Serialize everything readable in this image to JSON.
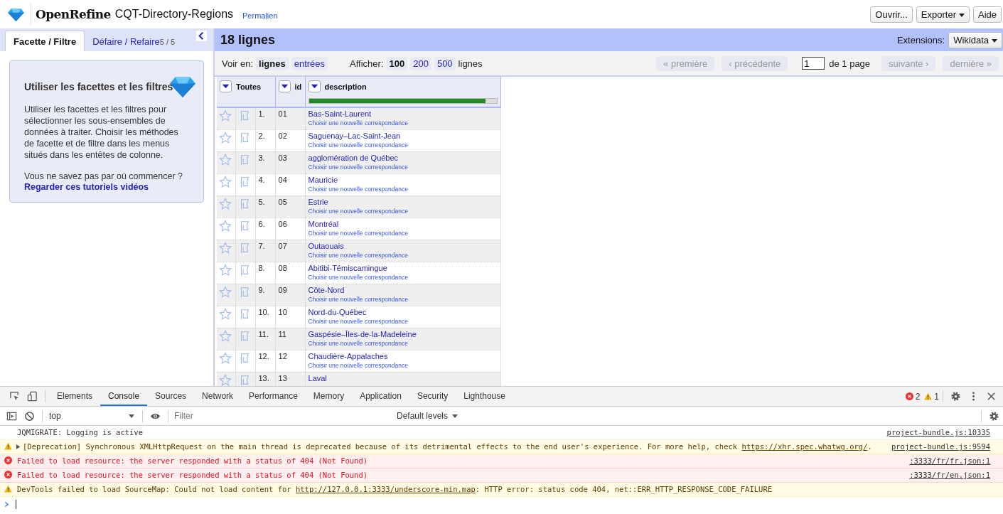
{
  "header": {
    "brand": "OpenRefine",
    "project": "CQT-Directory-Regions",
    "permalink": "Permalien",
    "buttons": [
      {
        "label": "Ouvrir...",
        "dropdown": false
      },
      {
        "label": "Exporter",
        "dropdown": true
      },
      {
        "label": "Aide",
        "dropdown": false
      }
    ]
  },
  "left_panel": {
    "tabs": [
      {
        "label": "Facette / Filtre",
        "selected": true
      },
      {
        "label": "Défaire / Refaire",
        "count": "5 / 5",
        "selected": false
      }
    ],
    "help": {
      "title": "Utiliser les facettes et les filtres",
      "body": "Utiliser les facettes et les filtres pour sélectionner les sous-ensembles de données à traiter. Choisir les méthodes de facette et de filtre dans les menus situés dans les entêtes de colonne.",
      "question": "Vous ne savez pas par où commencer ?",
      "link": "Regarder ces tutoriels vidéos"
    }
  },
  "summary": {
    "title": "18 lignes",
    "extensions_label": "Extensions:",
    "extensions_button": "Wikidata"
  },
  "toolbar": {
    "view_label": "Voir en:",
    "view_modes": [
      {
        "label": "lignes",
        "selected": true
      },
      {
        "label": "entrées",
        "selected": false
      }
    ],
    "show_label": "Afficher:",
    "page_sizes": [
      {
        "label": "100",
        "selected": true
      },
      {
        "label": "200",
        "selected": false
      },
      {
        "label": "500",
        "selected": false
      }
    ],
    "show_suffix": "lignes",
    "pager": {
      "first": {
        "label": "« première",
        "disabled": true
      },
      "prev": {
        "label": "‹ précédente",
        "disabled": true
      },
      "page": "1",
      "of": "de 1 page",
      "next": {
        "label": "suivante ›",
        "disabled": true
      },
      "last": {
        "label": "dernière »",
        "disabled": true
      }
    }
  },
  "table": {
    "columns": [
      {
        "label": "Toutes"
      },
      {
        "label": "id"
      },
      {
        "label": "description",
        "level": 0.94
      }
    ],
    "rows": [
      {
        "index": "1.",
        "id": "01",
        "description": "Bas-Saint-Laurent",
        "match_link": "Choisir une nouvelle correspondance"
      },
      {
        "index": "2.",
        "id": "02",
        "description": "Saguenay–Lac-Saint-Jean",
        "match_link": "Choisir une nouvelle correspondance"
      },
      {
        "index": "3.",
        "id": "03",
        "description": "agglomération de Québec",
        "match_link": "Choisir une nouvelle correspondance"
      },
      {
        "index": "4.",
        "id": "04",
        "description": "Mauricie",
        "match_link": "Choisir une nouvelle correspondance"
      },
      {
        "index": "5.",
        "id": "05",
        "description": "Estrie",
        "match_link": "Choisir une nouvelle correspondance"
      },
      {
        "index": "6.",
        "id": "06",
        "description": "Montréal",
        "match_link": "Choisir une nouvelle correspondance"
      },
      {
        "index": "7.",
        "id": "07",
        "description": "Outaouais",
        "match_link": "Choisir une nouvelle correspondance"
      },
      {
        "index": "8.",
        "id": "08",
        "description": "Abitibi-Témiscamingue",
        "match_link": "Choisir une nouvelle correspondance"
      },
      {
        "index": "9.",
        "id": "09",
        "description": "Côte-Nord",
        "match_link": "Choisir une nouvelle correspondance"
      },
      {
        "index": "10.",
        "id": "10",
        "description": "Nord-du-Québec",
        "match_link": "Choisir une nouvelle correspondance"
      },
      {
        "index": "11.",
        "id": "11",
        "description": "Gaspésie–Îles-de-la-Madeleine",
        "match_link": "Choisir une nouvelle correspondance"
      },
      {
        "index": "12.",
        "id": "12",
        "description": "Chaudière-Appalaches",
        "match_link": "Choisir une nouvelle correspondance"
      },
      {
        "index": "13.",
        "id": "13",
        "description": "Laval"
      }
    ]
  },
  "devtools": {
    "tabs": [
      {
        "label": "Elements",
        "selected": false
      },
      {
        "label": "Console",
        "selected": true
      },
      {
        "label": "Sources",
        "selected": false
      },
      {
        "label": "Network",
        "selected": false
      },
      {
        "label": "Performance",
        "selected": false
      },
      {
        "label": "Memory",
        "selected": false
      },
      {
        "label": "Application",
        "selected": false
      },
      {
        "label": "Security",
        "selected": false
      },
      {
        "label": "Lighthouse",
        "selected": false
      }
    ],
    "error_count": "2",
    "warning_count": "1",
    "context": "top",
    "filter_placeholder": "Filter",
    "levels": "Default levels",
    "messages": [
      {
        "kind": "log",
        "text": "JQMIGRATE: Logging is active",
        "source": "project-bundle.js:10335"
      },
      {
        "kind": "warning",
        "expandable": true,
        "text": "[Deprecation] Synchronous XMLHttpRequest on the main thread is deprecated because of its detrimental effects to the end user's experience. For more help, check ",
        "link": "https://xhr.spec.whatwg.org/",
        "after": ".",
        "source": "project-bundle.js:9594"
      },
      {
        "kind": "error",
        "text": "Failed to load resource: the server responded with a status of 404 (Not Found)",
        "source": ":3333/fr/fr.json:1"
      },
      {
        "kind": "error",
        "text": "Failed to load resource: the server responded with a status of 404 (Not Found)",
        "source": ":3333/fr/en.json:1"
      },
      {
        "kind": "warning",
        "text": "DevTools failed to load SourceMap: Could not load content for ",
        "link": "http://127.0.0.1:3333/underscore-min.map",
        "after": ": HTTP error: status code 404, net::ERR_HTTP_RESPONSE_CODE_FAILURE"
      }
    ]
  }
}
